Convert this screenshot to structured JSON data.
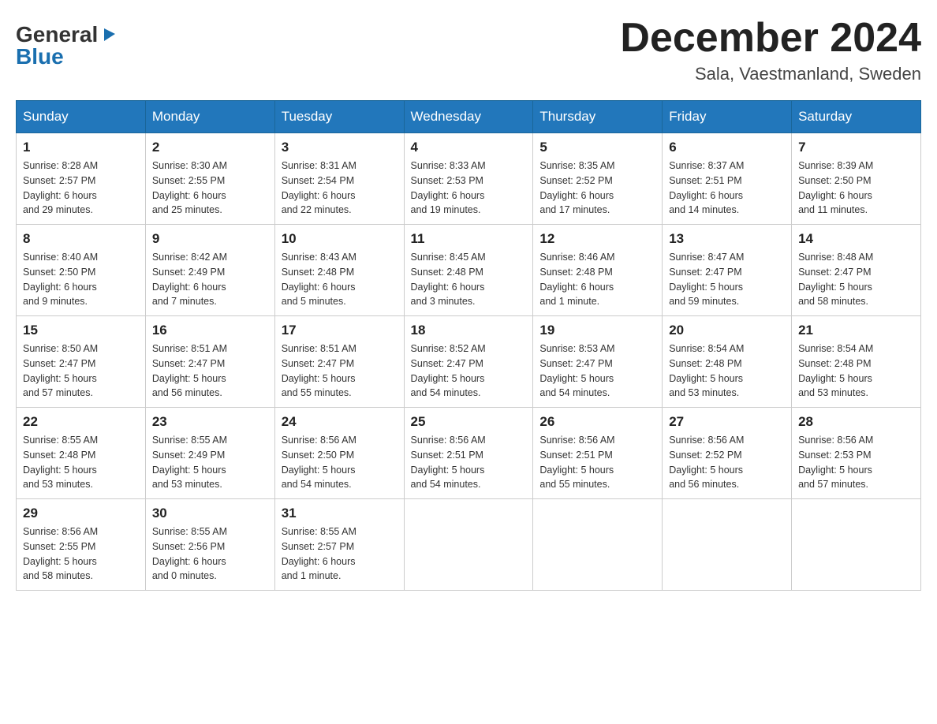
{
  "header": {
    "logo_general": "General",
    "logo_blue": "Blue",
    "month_title": "December 2024",
    "location": "Sala, Vaestmanland, Sweden"
  },
  "days_of_week": [
    "Sunday",
    "Monday",
    "Tuesday",
    "Wednesday",
    "Thursday",
    "Friday",
    "Saturday"
  ],
  "weeks": [
    [
      {
        "day": "1",
        "sunrise": "Sunrise: 8:28 AM",
        "sunset": "Sunset: 2:57 PM",
        "daylight": "Daylight: 6 hours",
        "daylight2": "and 29 minutes."
      },
      {
        "day": "2",
        "sunrise": "Sunrise: 8:30 AM",
        "sunset": "Sunset: 2:55 PM",
        "daylight": "Daylight: 6 hours",
        "daylight2": "and 25 minutes."
      },
      {
        "day": "3",
        "sunrise": "Sunrise: 8:31 AM",
        "sunset": "Sunset: 2:54 PM",
        "daylight": "Daylight: 6 hours",
        "daylight2": "and 22 minutes."
      },
      {
        "day": "4",
        "sunrise": "Sunrise: 8:33 AM",
        "sunset": "Sunset: 2:53 PM",
        "daylight": "Daylight: 6 hours",
        "daylight2": "and 19 minutes."
      },
      {
        "day": "5",
        "sunrise": "Sunrise: 8:35 AM",
        "sunset": "Sunset: 2:52 PM",
        "daylight": "Daylight: 6 hours",
        "daylight2": "and 17 minutes."
      },
      {
        "day": "6",
        "sunrise": "Sunrise: 8:37 AM",
        "sunset": "Sunset: 2:51 PM",
        "daylight": "Daylight: 6 hours",
        "daylight2": "and 14 minutes."
      },
      {
        "day": "7",
        "sunrise": "Sunrise: 8:39 AM",
        "sunset": "Sunset: 2:50 PM",
        "daylight": "Daylight: 6 hours",
        "daylight2": "and 11 minutes."
      }
    ],
    [
      {
        "day": "8",
        "sunrise": "Sunrise: 8:40 AM",
        "sunset": "Sunset: 2:50 PM",
        "daylight": "Daylight: 6 hours",
        "daylight2": "and 9 minutes."
      },
      {
        "day": "9",
        "sunrise": "Sunrise: 8:42 AM",
        "sunset": "Sunset: 2:49 PM",
        "daylight": "Daylight: 6 hours",
        "daylight2": "and 7 minutes."
      },
      {
        "day": "10",
        "sunrise": "Sunrise: 8:43 AM",
        "sunset": "Sunset: 2:48 PM",
        "daylight": "Daylight: 6 hours",
        "daylight2": "and 5 minutes."
      },
      {
        "day": "11",
        "sunrise": "Sunrise: 8:45 AM",
        "sunset": "Sunset: 2:48 PM",
        "daylight": "Daylight: 6 hours",
        "daylight2": "and 3 minutes."
      },
      {
        "day": "12",
        "sunrise": "Sunrise: 8:46 AM",
        "sunset": "Sunset: 2:48 PM",
        "daylight": "Daylight: 6 hours",
        "daylight2": "and 1 minute."
      },
      {
        "day": "13",
        "sunrise": "Sunrise: 8:47 AM",
        "sunset": "Sunset: 2:47 PM",
        "daylight": "Daylight: 5 hours",
        "daylight2": "and 59 minutes."
      },
      {
        "day": "14",
        "sunrise": "Sunrise: 8:48 AM",
        "sunset": "Sunset: 2:47 PM",
        "daylight": "Daylight: 5 hours",
        "daylight2": "and 58 minutes."
      }
    ],
    [
      {
        "day": "15",
        "sunrise": "Sunrise: 8:50 AM",
        "sunset": "Sunset: 2:47 PM",
        "daylight": "Daylight: 5 hours",
        "daylight2": "and 57 minutes."
      },
      {
        "day": "16",
        "sunrise": "Sunrise: 8:51 AM",
        "sunset": "Sunset: 2:47 PM",
        "daylight": "Daylight: 5 hours",
        "daylight2": "and 56 minutes."
      },
      {
        "day": "17",
        "sunrise": "Sunrise: 8:51 AM",
        "sunset": "Sunset: 2:47 PM",
        "daylight": "Daylight: 5 hours",
        "daylight2": "and 55 minutes."
      },
      {
        "day": "18",
        "sunrise": "Sunrise: 8:52 AM",
        "sunset": "Sunset: 2:47 PM",
        "daylight": "Daylight: 5 hours",
        "daylight2": "and 54 minutes."
      },
      {
        "day": "19",
        "sunrise": "Sunrise: 8:53 AM",
        "sunset": "Sunset: 2:47 PM",
        "daylight": "Daylight: 5 hours",
        "daylight2": "and 54 minutes."
      },
      {
        "day": "20",
        "sunrise": "Sunrise: 8:54 AM",
        "sunset": "Sunset: 2:48 PM",
        "daylight": "Daylight: 5 hours",
        "daylight2": "and 53 minutes."
      },
      {
        "day": "21",
        "sunrise": "Sunrise: 8:54 AM",
        "sunset": "Sunset: 2:48 PM",
        "daylight": "Daylight: 5 hours",
        "daylight2": "and 53 minutes."
      }
    ],
    [
      {
        "day": "22",
        "sunrise": "Sunrise: 8:55 AM",
        "sunset": "Sunset: 2:48 PM",
        "daylight": "Daylight: 5 hours",
        "daylight2": "and 53 minutes."
      },
      {
        "day": "23",
        "sunrise": "Sunrise: 8:55 AM",
        "sunset": "Sunset: 2:49 PM",
        "daylight": "Daylight: 5 hours",
        "daylight2": "and 53 minutes."
      },
      {
        "day": "24",
        "sunrise": "Sunrise: 8:56 AM",
        "sunset": "Sunset: 2:50 PM",
        "daylight": "Daylight: 5 hours",
        "daylight2": "and 54 minutes."
      },
      {
        "day": "25",
        "sunrise": "Sunrise: 8:56 AM",
        "sunset": "Sunset: 2:51 PM",
        "daylight": "Daylight: 5 hours",
        "daylight2": "and 54 minutes."
      },
      {
        "day": "26",
        "sunrise": "Sunrise: 8:56 AM",
        "sunset": "Sunset: 2:51 PM",
        "daylight": "Daylight: 5 hours",
        "daylight2": "and 55 minutes."
      },
      {
        "day": "27",
        "sunrise": "Sunrise: 8:56 AM",
        "sunset": "Sunset: 2:52 PM",
        "daylight": "Daylight: 5 hours",
        "daylight2": "and 56 minutes."
      },
      {
        "day": "28",
        "sunrise": "Sunrise: 8:56 AM",
        "sunset": "Sunset: 2:53 PM",
        "daylight": "Daylight: 5 hours",
        "daylight2": "and 57 minutes."
      }
    ],
    [
      {
        "day": "29",
        "sunrise": "Sunrise: 8:56 AM",
        "sunset": "Sunset: 2:55 PM",
        "daylight": "Daylight: 5 hours",
        "daylight2": "and 58 minutes."
      },
      {
        "day": "30",
        "sunrise": "Sunrise: 8:55 AM",
        "sunset": "Sunset: 2:56 PM",
        "daylight": "Daylight: 6 hours",
        "daylight2": "and 0 minutes."
      },
      {
        "day": "31",
        "sunrise": "Sunrise: 8:55 AM",
        "sunset": "Sunset: 2:57 PM",
        "daylight": "Daylight: 6 hours",
        "daylight2": "and 1 minute."
      },
      null,
      null,
      null,
      null
    ]
  ]
}
